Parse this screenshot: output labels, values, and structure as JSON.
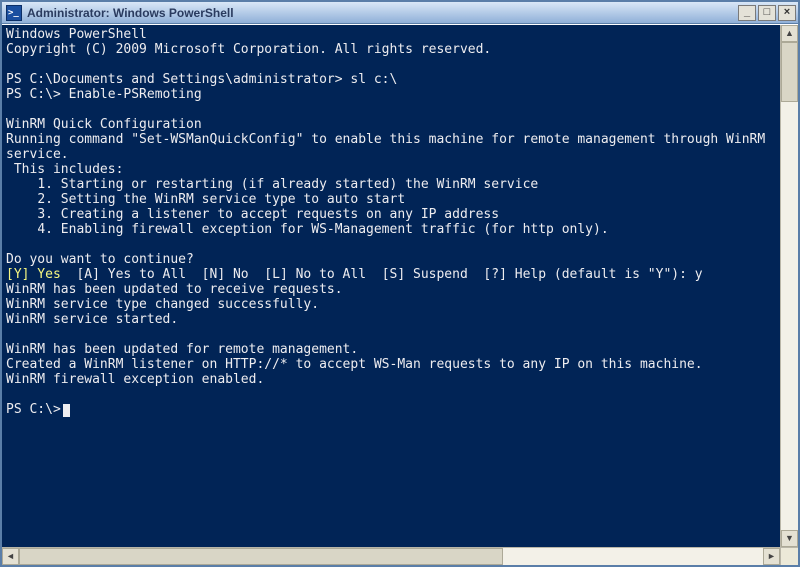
{
  "window": {
    "title": "Administrator: Windows PowerShell",
    "minimize_glyph": "_",
    "maximize_glyph": "□",
    "close_glyph": "×"
  },
  "console": {
    "banner1": "Windows PowerShell",
    "banner2": "Copyright (C) 2009 Microsoft Corporation. All rights reserved.",
    "prompt1": "PS C:\\Documents and Settings\\administrator> sl c:\\",
    "prompt2": "PS C:\\> Enable-PSRemoting",
    "qc_header": "WinRM Quick Configuration",
    "qc_line1": "Running command \"Set-WSManQuickConfig\" to enable this machine for remote management through WinRM service.",
    "qc_includes": " This includes:",
    "qc_i1": "    1. Starting or restarting (if already started) the WinRM service",
    "qc_i2": "    2. Setting the WinRM service type to auto start",
    "qc_i3": "    3. Creating a listener to accept requests on any IP address",
    "qc_i4": "    4. Enabling firewall exception for WS-Management traffic (for http only).",
    "continue_q": "Do you want to continue?",
    "choice_default": "[Y] Yes",
    "choice_rest": "  [A] Yes to All  [N] No  [L] No to All  [S] Suspend  [?] Help (default is \"Y\"): y",
    "res1": "WinRM has been updated to receive requests.",
    "res2": "WinRM service type changed successfully.",
    "res3": "WinRM service started.",
    "res4": "WinRM has been updated for remote management.",
    "res5": "Created a WinRM listener on HTTP://* to accept WS-Man requests to any IP on this machine.",
    "res6": "WinRM firewall exception enabled.",
    "final_prompt": "PS C:\\>"
  },
  "scroll": {
    "up": "▲",
    "down": "▼",
    "left": "◄",
    "right": "►"
  }
}
